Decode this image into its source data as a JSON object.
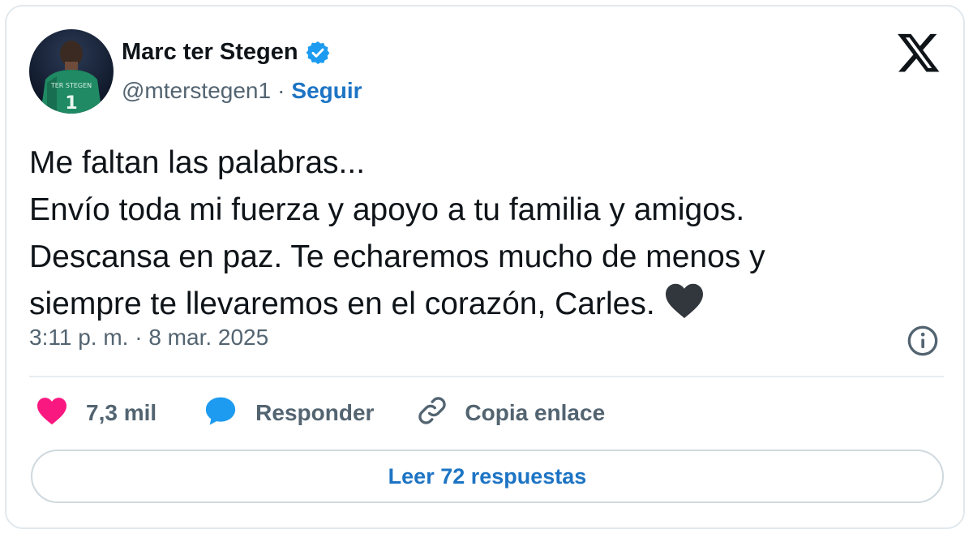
{
  "author": {
    "name": "Marc ter Stegen",
    "handle": "@mterstegen1",
    "separator": "·",
    "follow_label": "Seguir",
    "verified": true
  },
  "tweet": {
    "lines": [
      "Me faltan las palabras...",
      "Envío toda mi fuerza y apoyo a tu familia y amigos.",
      "Descansa en paz. Te echaremos mucho de menos y",
      "siempre te llevaremos en el corazón, Carles."
    ],
    "emoji": "black-heart-icon",
    "timestamp": "3:11 p. m. · 8 mar. 2025"
  },
  "actions": {
    "likes": "7,3 mil",
    "reply_label": "Responder",
    "copy_label": "Copia enlace",
    "read_replies_label": "Leer 72 respuestas"
  },
  "icons": [
    "x-logo-icon",
    "verified-badge-icon",
    "info-icon",
    "heart-icon",
    "reply-bubble-icon",
    "link-icon"
  ],
  "colors": {
    "link_blue": "#1d74c4",
    "verified_blue": "#1d9bf0",
    "like_pink": "#f91880",
    "muted_text": "#536471",
    "border": "#cfd9de"
  }
}
